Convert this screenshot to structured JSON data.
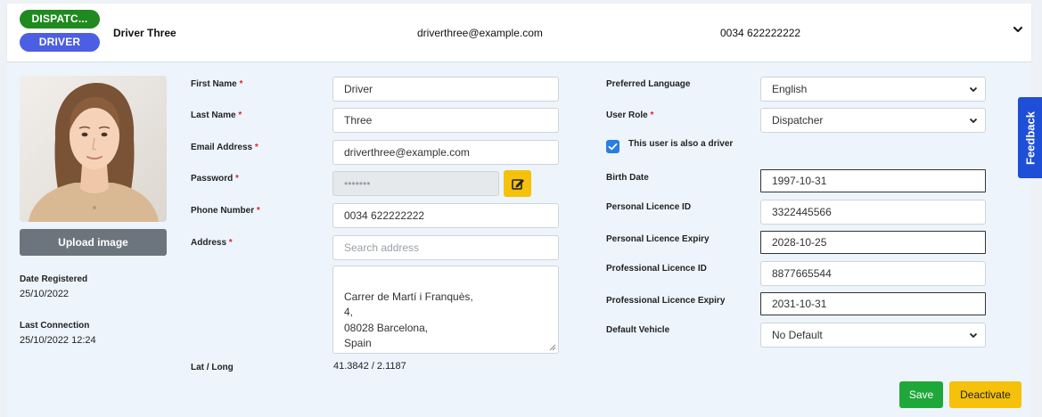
{
  "header": {
    "role_pill": "DISPATC...",
    "driver_pill": "DRIVER",
    "name": "Driver Three",
    "email": "driverthree@example.com",
    "phone": "0034 622222222",
    "expand_icon": "chevron-down-icon"
  },
  "profile": {
    "upload_label": "Upload image",
    "date_registered_label": "Date Registered",
    "date_registered": "25/10/2022",
    "last_connection_label": "Last Connection",
    "last_connection": "25/10/2022 12:24"
  },
  "form": {
    "first_name_label": "First Name",
    "first_name": "Driver",
    "last_name_label": "Last Name",
    "last_name": "Three",
    "email_label": "Email Address",
    "email": "driverthree@example.com",
    "password_label": "Password",
    "password": "•••••••",
    "edit_icon": "edit-icon",
    "phone_label": "Phone Number",
    "phone": "0034 622222222",
    "address_label": "Address",
    "address_search_placeholder": "Search address",
    "address_text": "Carrer de Martí i Franquès,\n4,\n08028 Barcelona,\nSpain",
    "latlong_label": "Lat / Long",
    "latlong": "41.3842 / 2.1187",
    "required_mark": "*"
  },
  "settings": {
    "language_label": "Preferred Language",
    "language": "English",
    "role_label": "User Role",
    "role": "Dispatcher",
    "is_driver_label": "This user is also a driver",
    "is_driver": true,
    "birth_date_label": "Birth Date",
    "birth_date": "1997-10-31",
    "personal_licence_id_label": "Personal Licence ID",
    "personal_licence_id": "3322445566",
    "personal_licence_expiry_label": "Personal Licence Expiry",
    "personal_licence_expiry": "2028-10-25",
    "professional_licence_id_label": "Professional Licence ID",
    "professional_licence_id": "8877665544",
    "professional_licence_expiry_label": "Professional Licence Expiry",
    "professional_licence_expiry": "2031-10-31",
    "default_vehicle_label": "Default Vehicle",
    "default_vehicle": "No Default"
  },
  "actions": {
    "save": "Save",
    "deactivate": "Deactivate"
  },
  "feedback_tab": "Feedback",
  "colors": {
    "role_pill": "#1f8a1f",
    "driver_pill": "#4b5ee4",
    "save": "#1fa83a",
    "deactivate": "#f5c10a",
    "feedback": "#1f4fd6",
    "checkbox": "#2a7de1"
  }
}
